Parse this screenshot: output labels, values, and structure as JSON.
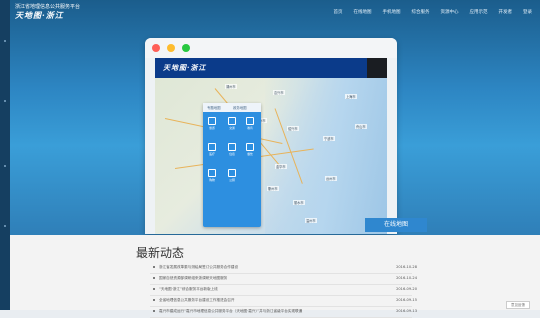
{
  "header": {
    "portal_name": "浙江省地理信息公共服务平台",
    "logo_text": "天地图·浙江",
    "nav": [
      "首页",
      "在线地图",
      "手机地图",
      "综合服务",
      "资源中心",
      "应用示范",
      "开发者",
      "登录"
    ]
  },
  "mockup": {
    "logo_text": "天地图·浙江",
    "panel_tabs": [
      "专题地图",
      "政务地图"
    ],
    "panel_tiles": [
      "旅游",
      "交通",
      "教育",
      "医疗",
      "住宿",
      "餐饮",
      "购物",
      "公厕"
    ],
    "map_labels": [
      "湖州市",
      "嘉兴市",
      "杭州市",
      "绍兴市",
      "宁波市",
      "舟山市",
      "金华市",
      "台州市",
      "衢州市",
      "丽水市",
      "温州市",
      "上海市"
    ],
    "traffic_colors": [
      "#ff5f57",
      "#febc2e",
      "#28c840"
    ]
  },
  "online_map_button": "在线地图",
  "news": {
    "title": "最新动态",
    "items": [
      {
        "text": "浙江省发展改革委与测绘局签订公共服务合作建设",
        "date": "2016-10-28"
      },
      {
        "text": "国家自然资源部调研组来浙调研天地图服务",
        "date": "2016-10-24"
      },
      {
        "text": "“天地图·浙江”综合服务平台新版上线",
        "date": "2016-09-20"
      },
      {
        "text": "全省地理信息公共服务平台建设工作推进会召开",
        "date": "2016-09-15"
      },
      {
        "text": "嘉兴市建成运行“嘉兴市地理信息公共服务平台（天地图·嘉兴）”并与浙江省级平台实现联通",
        "date": "2016-09-13"
      }
    ]
  },
  "feedback_label": "意见反馈"
}
